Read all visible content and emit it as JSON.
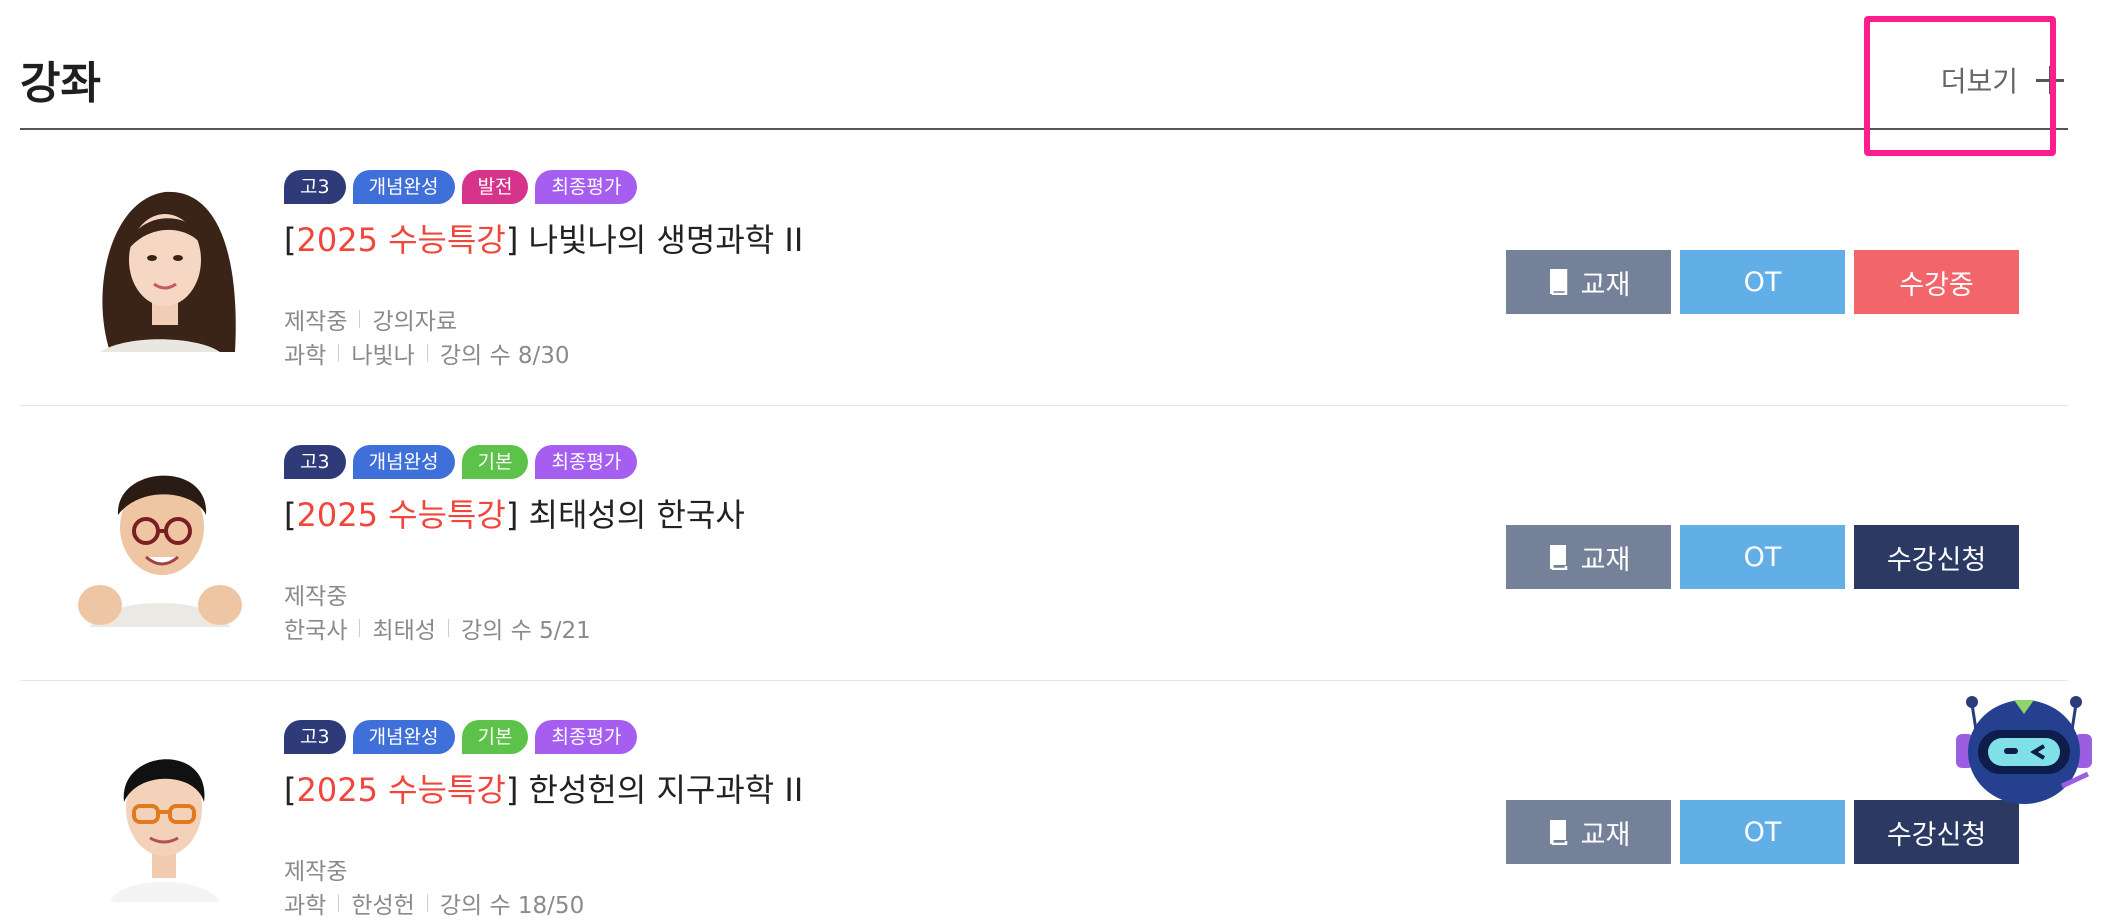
{
  "section": {
    "title": "강좌",
    "more_label": "더보기"
  },
  "colors": {
    "accent_red": "#f0463c",
    "highlight_box": "#ff1e8c",
    "tag_grade": "#2f3a78",
    "tag_concept": "#3f6fd8",
    "tag_advanced": "#d6338a",
    "tag_basic": "#5cc24a",
    "tag_final": "#a55ef0"
  },
  "courses": [
    {
      "tags": [
        "고3",
        "개념완성",
        "발전",
        "최종평가"
      ],
      "title_open": "[",
      "title_highlight": "2025 수능특강",
      "title_rest": "] 나빛나의 생명과학 II",
      "status": "제작중",
      "resource": "강의자료",
      "subject": "과학",
      "teacher": "나빛나",
      "lecture_count": "강의 수 8/30",
      "btn_book": "교재",
      "btn_ot": "OT",
      "btn_action": "수강중"
    },
    {
      "tags": [
        "고3",
        "개념완성",
        "기본",
        "최종평가"
      ],
      "title_open": "[",
      "title_highlight": "2025 수능특강",
      "title_rest": "] 최태성의 한국사",
      "status": "제작중",
      "subject": "한국사",
      "teacher": "최태성",
      "lecture_count": "강의 수 5/21",
      "btn_book": "교재",
      "btn_ot": "OT",
      "btn_action": "수강신청"
    },
    {
      "tags": [
        "고3",
        "개념완성",
        "기본",
        "최종평가"
      ],
      "title_open": "[",
      "title_highlight": "2025 수능특강",
      "title_rest": "] 한성헌의 지구과학 II",
      "status": "제작중",
      "subject": "과학",
      "teacher": "한성헌",
      "lecture_count": "강의 수 18/50",
      "btn_book": "교재",
      "btn_ot": "OT",
      "btn_action": "수강신청"
    }
  ]
}
